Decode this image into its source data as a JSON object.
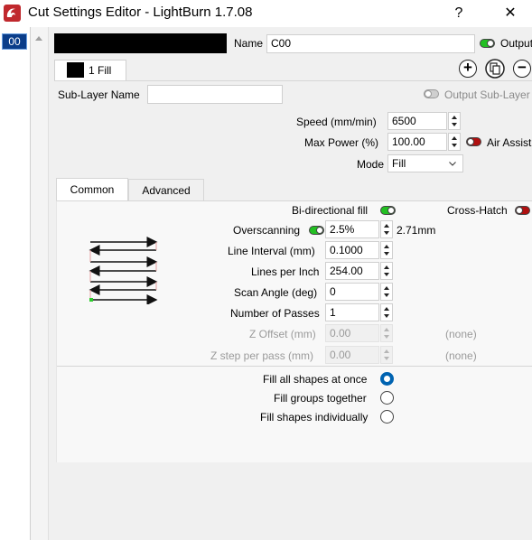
{
  "window": {
    "title": "Cut Settings Editor - LightBurn 1.7.08",
    "help_label": "?",
    "close_label": "✕"
  },
  "layers": [
    {
      "index_label": "00"
    }
  ],
  "layer": {
    "name_label": "Name",
    "name_value": "C00",
    "output_label": "Output",
    "color": "#000000"
  },
  "sublayer_tab": {
    "label": "1 Fill"
  },
  "sublayer": {
    "name_label": "Sub-Layer Name",
    "name_value": "",
    "output_label": "Output Sub-Layer"
  },
  "speed": {
    "label": "Speed (mm/min)",
    "value": "6500"
  },
  "max_power": {
    "label": "Max Power (%)",
    "value": "100.00"
  },
  "air_assist": {
    "label": "Air Assist"
  },
  "mode": {
    "label": "Mode",
    "value": "Fill"
  },
  "tabs": {
    "common": "Common",
    "advanced": "Advanced"
  },
  "common": {
    "bidir_label": "Bi-directional fill",
    "crosshatch_label": "Cross-Hatch",
    "overscan_label": "Overscanning",
    "overscan_value": "2.5%",
    "overscan_computed": "2.71mm",
    "line_interval_label": "Line Interval (mm)",
    "line_interval_value": "0.1000",
    "lpi_label": "Lines per Inch",
    "lpi_value": "254.00",
    "scan_angle_label": "Scan Angle (deg)",
    "scan_angle_value": "0",
    "passes_label": "Number of Passes",
    "passes_value": "1",
    "z_offset_label": "Z Offset (mm)",
    "z_offset_value": "0.00",
    "z_offset_none": "(none)",
    "z_step_label": "Z step per pass (mm)",
    "z_step_value": "0.00",
    "z_step_none": "(none)",
    "fill_at_once": "Fill all shapes at once",
    "fill_groups": "Fill groups together",
    "fill_individually": "Fill shapes individually",
    "fill_selected": "Fill all shapes at once"
  },
  "colors": {
    "accent": "#0063b1",
    "toggle_on": "#22c022",
    "toggle_red": "#b01010",
    "selection": "#0a3d8a"
  }
}
